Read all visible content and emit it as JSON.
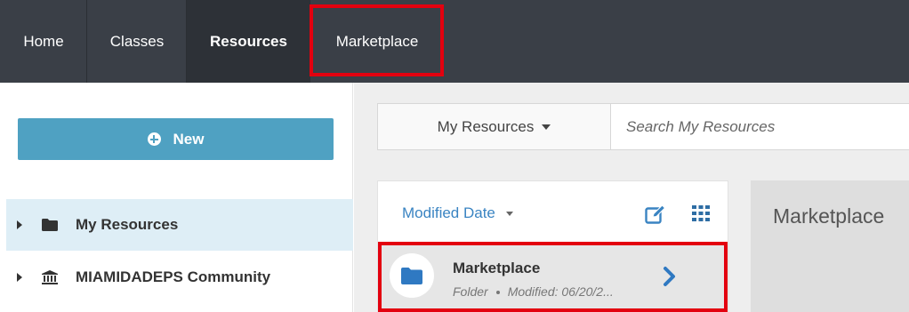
{
  "nav": {
    "items": [
      {
        "label": "Home"
      },
      {
        "label": "Classes"
      },
      {
        "label": "Resources"
      },
      {
        "label": "Marketplace"
      }
    ],
    "active": "Resources"
  },
  "sidebar": {
    "new_button": {
      "label": "New",
      "icon": "plus-circle-icon"
    },
    "tree": [
      {
        "label": "My Resources",
        "icon": "folder-icon",
        "selected": true
      },
      {
        "label": "MIAMIDADEPS Community",
        "icon": "institution-icon",
        "selected": false
      }
    ]
  },
  "toolbar": {
    "scope_dropdown": "My Resources",
    "search_placeholder": "Search My Resources"
  },
  "list": {
    "sort_label": "Modified Date",
    "items": [
      {
        "title": "Marketplace",
        "type": "Folder",
        "modified": "Modified: 06/20/2..."
      }
    ]
  },
  "preview": {
    "title": "Marketplace"
  },
  "colors": {
    "nav_bg": "#3a3f47",
    "accent": "#4fa1c2",
    "link": "#3a84c2",
    "highlight": "#e3000f",
    "selected_bg": "#deeef6"
  }
}
